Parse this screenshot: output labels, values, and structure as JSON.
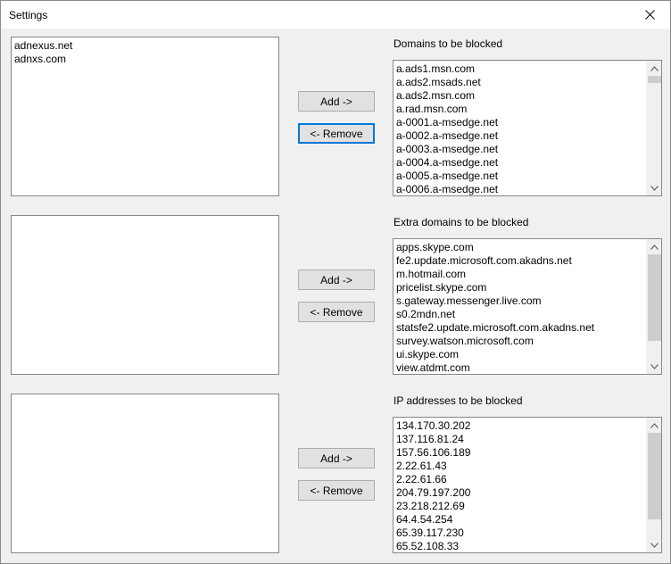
{
  "window": {
    "title": "Settings"
  },
  "sections": [
    {
      "left_items": [
        "adnexus.net",
        "adnxs.com"
      ],
      "label": "Domains to be blocked",
      "add_label": "Add ->",
      "remove_label": "<- Remove",
      "right_items": [
        "a.ads1.msn.com",
        "a.ads2.msads.net",
        "a.ads2.msn.com",
        "a.rad.msn.com",
        "a-0001.a-msedge.net",
        "a-0002.a-msedge.net",
        "a-0003.a-msedge.net",
        "a-0004.a-msedge.net",
        "a-0005.a-msedge.net",
        "a-0006.a-msedge.net"
      ],
      "scroll_position": 0.0,
      "scroll_visible_fraction": 0.05
    },
    {
      "left_items": [],
      "label": "Extra domains to be blocked",
      "add_label": "Add ->",
      "remove_label": "<- Remove",
      "right_items": [
        "apps.skype.com",
        "fe2.update.microsoft.com.akadns.net",
        "m.hotmail.com",
        "pricelist.skype.com",
        "s.gateway.messenger.live.com",
        "s0.2mdn.net",
        "statsfe2.update.microsoft.com.akadns.net",
        "survey.watson.microsoft.com",
        "ui.skype.com",
        "view.atdmt.com"
      ],
      "scroll_position": 0.0,
      "scroll_visible_fraction": 0.83
    },
    {
      "left_items": [],
      "label": "IP addresses to be blocked",
      "add_label": "Add ->",
      "remove_label": "<- Remove",
      "right_items": [
        "134.170.30.202",
        "137.116.81.24",
        "157.56.106.189",
        "2.22.61.43",
        "2.22.61.66",
        "204.79.197.200",
        "23.218.212.69",
        "64.4.54.254",
        "65.39.117.230",
        "65.52.108.33"
      ],
      "scroll_position": 0.0,
      "scroll_visible_fraction": 0.83
    }
  ],
  "colors": {
    "accent": "#0078d7",
    "face": "#f0f0f0",
    "button": "#e1e1e1",
    "thumb": "#cdcdcd"
  }
}
